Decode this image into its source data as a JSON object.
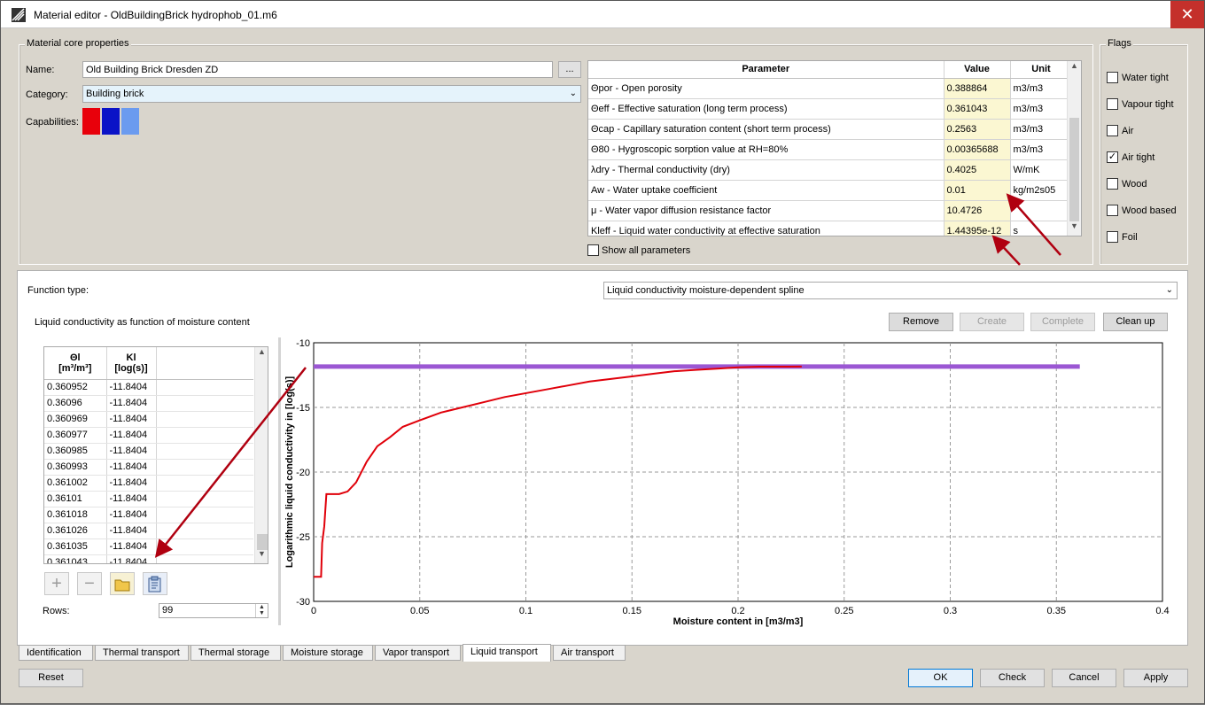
{
  "window": {
    "title": "Material editor - OldBuildingBrick hydrophob_01.m6",
    "close": "✕"
  },
  "core": {
    "group_title": "Material core properties",
    "name_label": "Name:",
    "name_value": "Old Building Brick Dresden ZD",
    "browse_label": "...",
    "category_label": "Category:",
    "category_value": "Building brick",
    "capabilities_label": "Capabilities:",
    "capability_colors": [
      "#e8000b",
      "#0a13c7",
      "#6b9bef"
    ]
  },
  "params": {
    "headers": {
      "parameter": "Parameter",
      "value": "Value",
      "unit": "Unit"
    },
    "rows": [
      {
        "parameter": "Θpor - Open porosity",
        "value": "0.388864",
        "unit": "m3/m3"
      },
      {
        "parameter": "Θeff - Effective saturation (long term process)",
        "value": "0.361043",
        "unit": "m3/m3"
      },
      {
        "parameter": "Θcap - Capillary saturation content (short term process)",
        "value": "0.2563",
        "unit": "m3/m3"
      },
      {
        "parameter": "Θ80 - Hygroscopic sorption value at RH=80%",
        "value": "0.00365688",
        "unit": "m3/m3"
      },
      {
        "parameter": "λdry - Thermal conductivity (dry)",
        "value": "0.4025",
        "unit": "W/mK"
      },
      {
        "parameter": "Aw - Water uptake coefficient",
        "value": "0.01",
        "unit": "kg/m2s05"
      },
      {
        "parameter": "μ - Water vapor diffusion resistance factor",
        "value": "10.4726",
        "unit": ""
      },
      {
        "parameter": "Kleff - Liquid water conductivity at effective saturation",
        "value": "1.44395e-12",
        "unit": "s"
      }
    ],
    "show_all_label": "Show all parameters"
  },
  "flags": {
    "group_title": "Flags",
    "items": [
      {
        "label": "Water tight",
        "checked": false
      },
      {
        "label": "Vapour tight",
        "checked": false
      },
      {
        "label": "Air",
        "checked": false
      },
      {
        "label": "Air tight",
        "checked": true
      },
      {
        "label": "Wood",
        "checked": false
      },
      {
        "label": "Wood based",
        "checked": false
      },
      {
        "label": "Foil",
        "checked": false
      }
    ]
  },
  "function": {
    "type_label": "Function type:",
    "type_value": "Liquid conductivity moisture-dependent spline",
    "subtitle": "Liquid conductivity as function of moisture content",
    "buttons": {
      "remove": "Remove",
      "create": "Create",
      "complete": "Complete",
      "cleanup": "Clean up"
    }
  },
  "data_table": {
    "col1": "Θl",
    "col1_unit": "[m³/m³]",
    "col2": "Kl",
    "col2_unit": "[log(s)]",
    "rows": [
      [
        "0.360952",
        "-11.8404"
      ],
      [
        "0.36096",
        "-11.8404"
      ],
      [
        "0.360969",
        "-11.8404"
      ],
      [
        "0.360977",
        "-11.8404"
      ],
      [
        "0.360985",
        "-11.8404"
      ],
      [
        "0.360993",
        "-11.8404"
      ],
      [
        "0.361002",
        "-11.8404"
      ],
      [
        "0.36101",
        "-11.8404"
      ],
      [
        "0.361018",
        "-11.8404"
      ],
      [
        "0.361026",
        "-11.8404"
      ],
      [
        "0.361035",
        "-11.8404"
      ],
      [
        "0.361043",
        "-11.8404"
      ]
    ],
    "rows_label": "Rows:",
    "rows_value": "99"
  },
  "chart_data": {
    "type": "line",
    "xlabel": "Moisture content in [m3/m3]",
    "ylabel": "Logarithmic liquid conductivity in [log(s)]",
    "xlim": [
      0,
      0.4
    ],
    "ylim": [
      -30,
      -10
    ],
    "xticks": [
      "0",
      "0.05",
      "0.1",
      "0.15",
      "0.2",
      "0.25",
      "0.3",
      "0.35",
      "0.4"
    ],
    "yticks": [
      "-10",
      "-15",
      "-20",
      "-25",
      "-30"
    ],
    "grid": true,
    "series": [
      {
        "color": "#e0000a",
        "x": [
          0,
          0.0035,
          0.004,
          0.005,
          0.006,
          0.012,
          0.016,
          0.02,
          0.025,
          0.03,
          0.036,
          0.042,
          0.05,
          0.06,
          0.07,
          0.08,
          0.09,
          0.1,
          0.11,
          0.12,
          0.13,
          0.14,
          0.15,
          0.16,
          0.17,
          0.18,
          0.19,
          0.2,
          0.21,
          0.22,
          0.23
        ],
        "y": [
          -28.1,
          -28.1,
          -25.5,
          -24.2,
          -21.7,
          -21.7,
          -21.5,
          -20.8,
          -19.2,
          -18.0,
          -17.3,
          -16.5,
          -16.0,
          -15.4,
          -15.0,
          -14.6,
          -14.2,
          -13.9,
          -13.6,
          -13.3,
          -13.0,
          -12.8,
          -12.6,
          -12.4,
          -12.2,
          -12.1,
          -12.0,
          -11.9,
          -11.85,
          -11.85,
          -11.84
        ]
      },
      {
        "color": "#9b57d3",
        "x": [
          0,
          0.361043
        ],
        "y": [
          -11.8404,
          -11.8404
        ]
      }
    ]
  },
  "tabs": [
    "Identification",
    "Thermal transport",
    "Thermal storage",
    "Moisture storage",
    "Vapor transport",
    "Liquid transport",
    "Air transport"
  ],
  "active_tab": "Liquid transport",
  "footer": {
    "reset": "Reset",
    "ok": "OK",
    "check": "Check",
    "cancel": "Cancel",
    "apply": "Apply"
  }
}
